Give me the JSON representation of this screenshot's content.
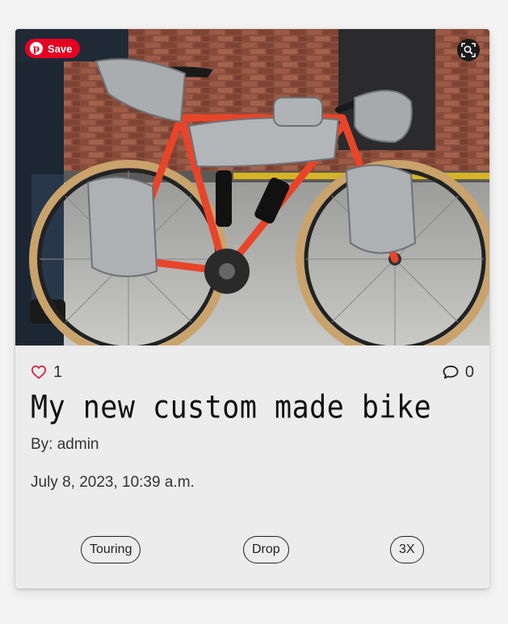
{
  "post": {
    "title": "My new custom made bike",
    "author_prefix": "By: ",
    "author": "admin",
    "date": "July 8, 2023, 10:39 a.m.",
    "likes": "1",
    "comments": "0",
    "like_icon": "heart-outline-icon",
    "comment_icon": "speech-bubble-icon"
  },
  "image_overlay": {
    "pin_label": "Save",
    "pin_icon": "pinterest-icon",
    "zoom_icon": "zoom-search-icon"
  },
  "tags": [
    {
      "label": "Touring"
    },
    {
      "label": "Drop"
    },
    {
      "label": "3X"
    }
  ],
  "colors": {
    "accent_red": "#e60023",
    "heart_red": "#d0243a",
    "card_bg": "#ececec"
  }
}
